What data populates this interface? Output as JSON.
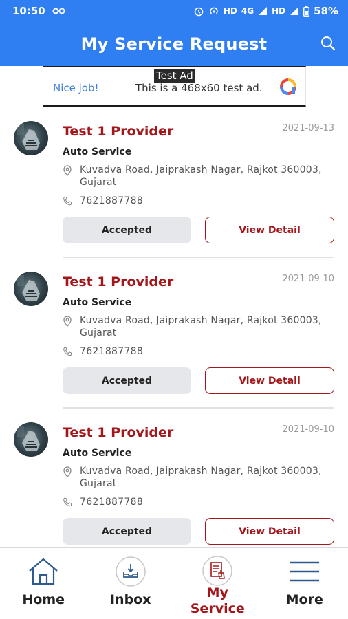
{
  "status_bar": {
    "time": "10:50",
    "network_1": "HD",
    "network_2": "4G",
    "network_3": "HD",
    "battery": "58%"
  },
  "app_bar": {
    "title": "My Service Request",
    "search_icon": "search-icon"
  },
  "ad": {
    "label": "Test Ad",
    "nice": "Nice job!",
    "text": "This is a 468x60 test ad."
  },
  "requests": [
    {
      "provider": "Test 1 Provider",
      "date": "2021-09-13",
      "service": "Auto Service",
      "address": "Kuvadva Road, Jaiprakash Nagar, Rajkot 360003, Gujarat",
      "phone": "7621887788",
      "status": "Accepted",
      "detail_label": "View Detail"
    },
    {
      "provider": "Test 1 Provider",
      "date": "2021-09-10",
      "service": "Auto Service",
      "address": "Kuvadva Road, Jaiprakash Nagar, Rajkot 360003, Gujarat",
      "phone": "7621887788",
      "status": "Accepted",
      "detail_label": "View Detail"
    },
    {
      "provider": "Test 1 Provider",
      "date": "2021-09-10",
      "service": "Auto Service",
      "address": "Kuvadva Road, Jaiprakash Nagar, Rajkot 360003, Gujarat",
      "phone": "7621887788",
      "status": "Accepted",
      "detail_label": "View Detail"
    }
  ],
  "bottom_nav": {
    "home": "Home",
    "inbox": "Inbox",
    "my_service_request": "My Service Request",
    "more": "More",
    "active": "my_service_request"
  },
  "colors": {
    "primary": "#2f7ff2",
    "accent": "#a3161a",
    "status_bg": "#e6e7ea"
  }
}
